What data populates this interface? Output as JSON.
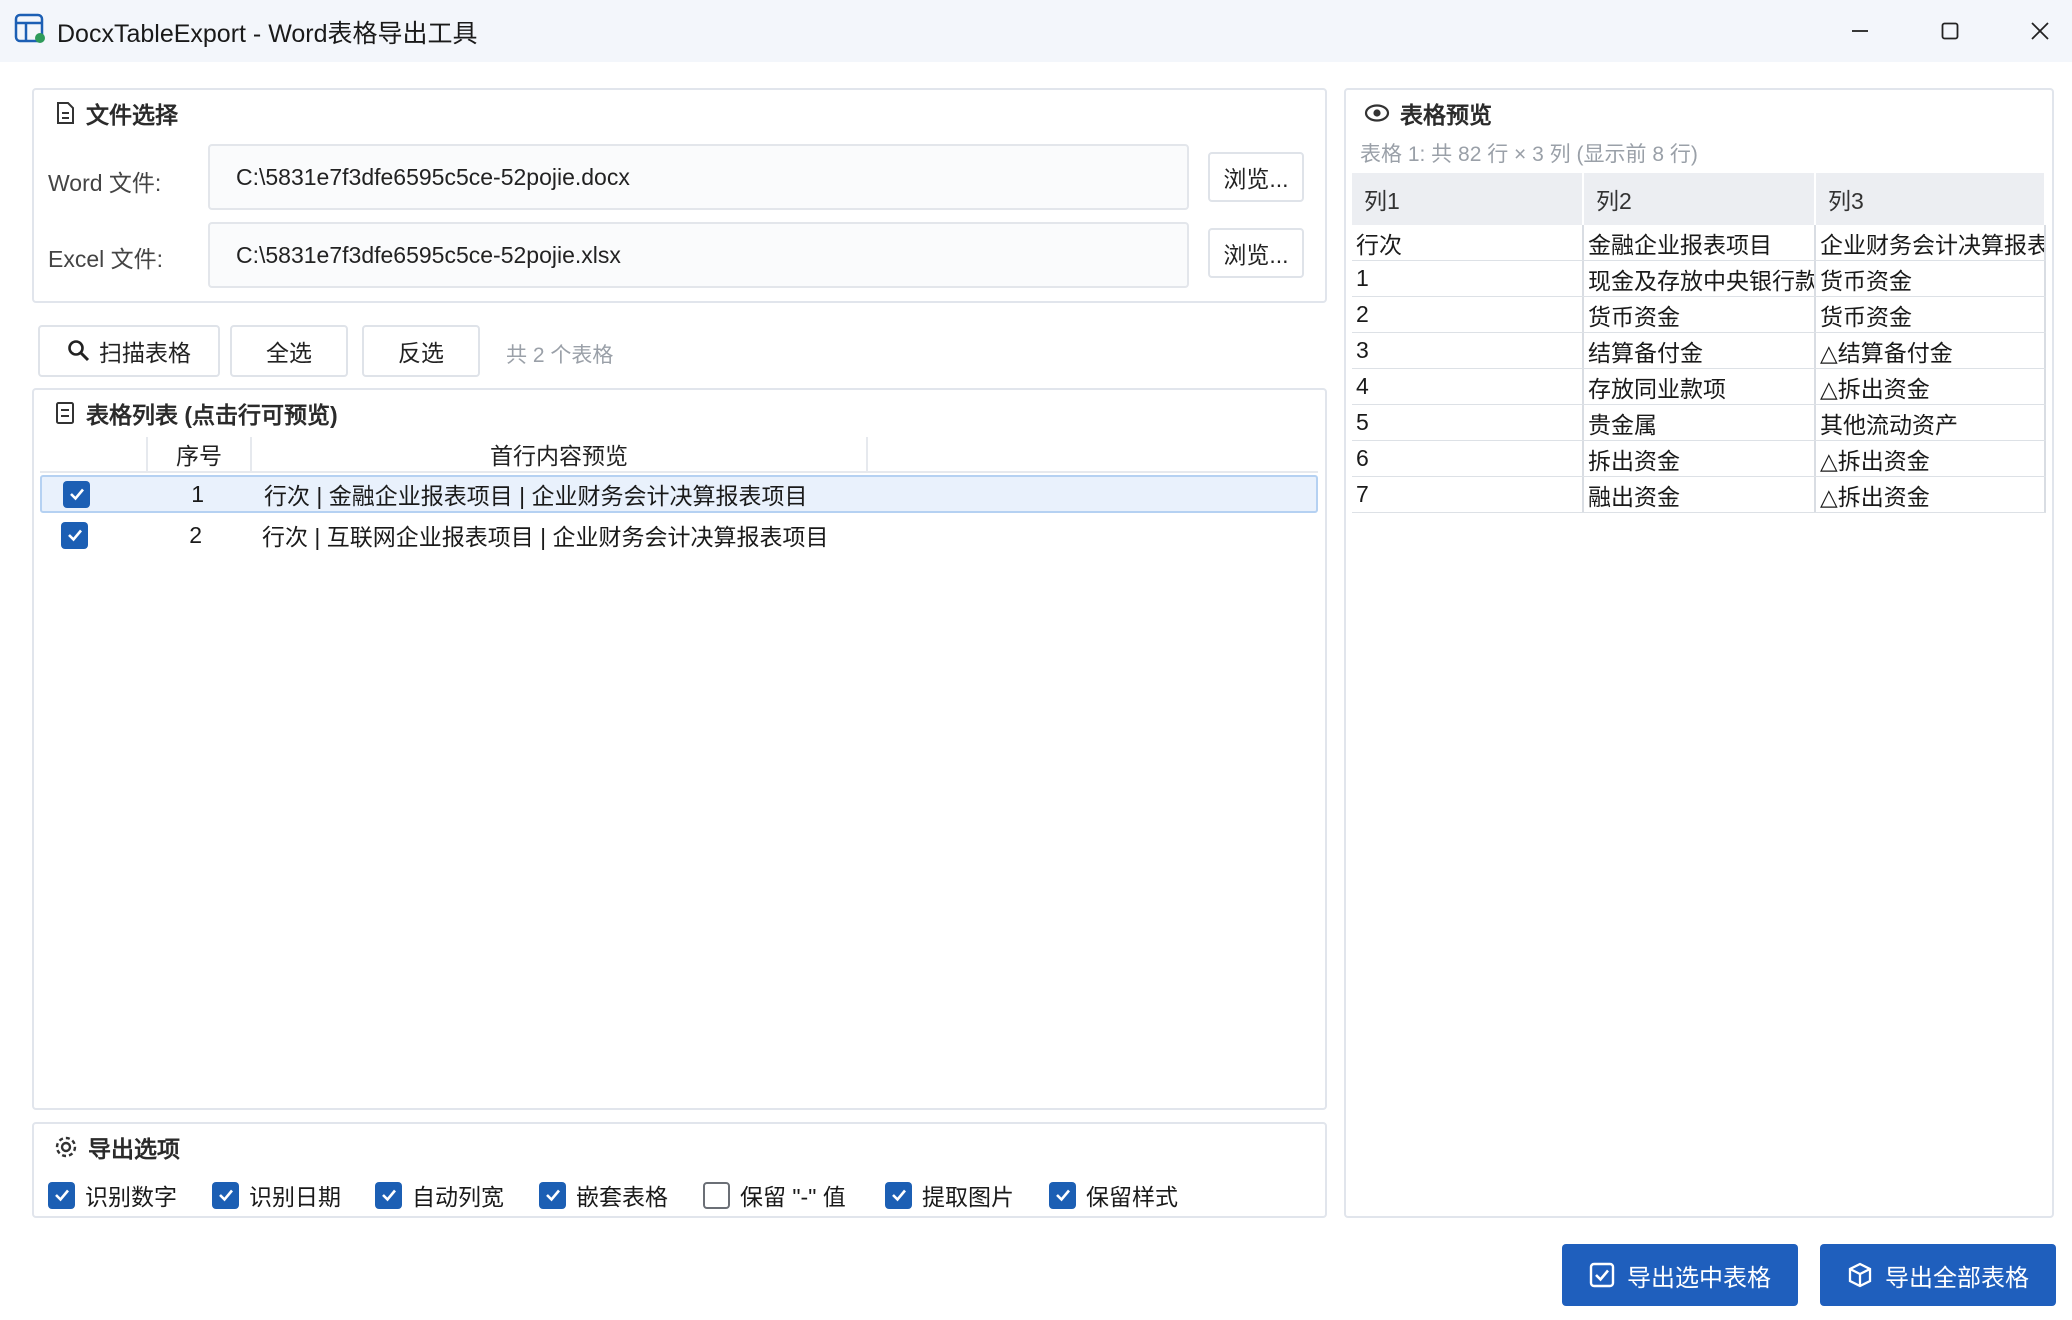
{
  "window": {
    "title": "DocxTableExport - Word表格导出工具",
    "minimize_icon": "minimize-icon",
    "maximize_icon": "maximize-icon",
    "close_icon": "close-icon"
  },
  "file_section": {
    "title": "文件选择",
    "word_label": "Word 文件:",
    "word_value": "C:\\5831e7f3dfe6595c5ce-52pojie.docx",
    "excel_label": "Excel 文件:",
    "excel_value": "C:\\5831e7f3dfe6595c5ce-52pojie.xlsx",
    "browse_label": "浏览..."
  },
  "toolbar": {
    "scan_label": "扫描表格",
    "select_all_label": "全选",
    "invert_label": "反选",
    "count_text": "共 2 个表格"
  },
  "table_list": {
    "title": "表格列表 (点击行可预览)",
    "col_index": "序号",
    "col_preview": "首行内容预览",
    "rows": [
      {
        "checked": true,
        "index": "1",
        "preview": "行次 | 金融企业报表项目 | 企业财务会计决算报表项目"
      },
      {
        "checked": true,
        "index": "2",
        "preview": "行次 | 互联网企业报表项目 | 企业财务会计决算报表项目"
      }
    ]
  },
  "preview": {
    "title": "表格预览",
    "subtitle": "表格 1: 共 82 行 × 3 列 (显示前 8 行)",
    "columns": [
      "列1",
      "列2",
      "列3"
    ],
    "rows": [
      [
        "行次",
        "金融企业报表项目",
        "企业财务会计决算报表"
      ],
      [
        "1",
        "现金及存放中央银行款项",
        "货币资金"
      ],
      [
        "2",
        "货币资金",
        "货币资金"
      ],
      [
        "3",
        "结算备付金",
        "△结算备付金"
      ],
      [
        "4",
        "存放同业款项",
        "△拆出资金"
      ],
      [
        "5",
        "贵金属",
        "其他流动资产"
      ],
      [
        "6",
        "拆出资金",
        "△拆出资金"
      ],
      [
        "7",
        "融出资金",
        "△拆出资金"
      ]
    ]
  },
  "export_options": {
    "title": "导出选项",
    "items": [
      {
        "label": "识别数字",
        "checked": true
      },
      {
        "label": "识别日期",
        "checked": true
      },
      {
        "label": "自动列宽",
        "checked": true
      },
      {
        "label": "嵌套表格",
        "checked": true
      },
      {
        "label": "保留 \"-\" 值",
        "checked": false
      },
      {
        "label": "提取图片",
        "checked": true
      },
      {
        "label": "保留样式",
        "checked": true
      }
    ]
  },
  "actions": {
    "export_selected_label": "导出选中表格",
    "export_all_label": "导出全部表格"
  },
  "colors": {
    "accent": "#1f5fbd",
    "selected_row": "#e9f1fc",
    "border": "#e1e5ec"
  }
}
